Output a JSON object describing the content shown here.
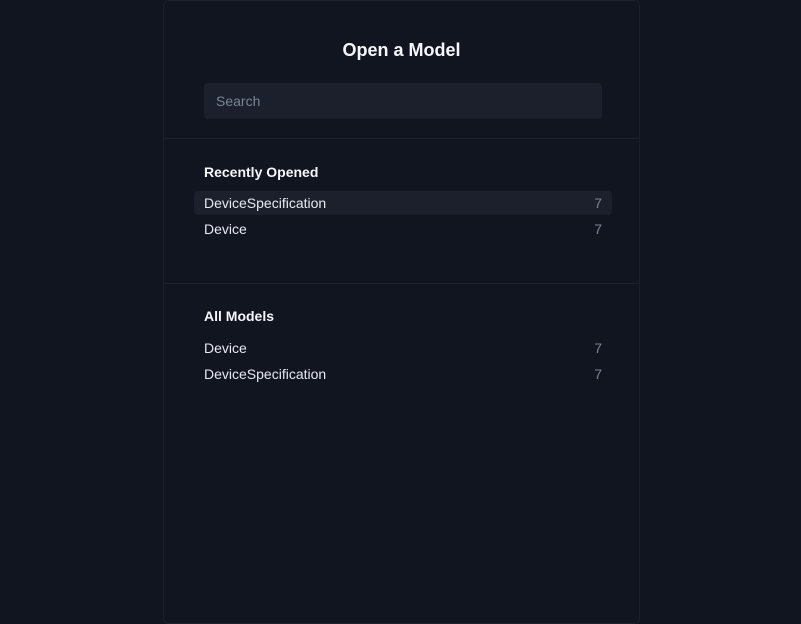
{
  "dialog": {
    "title": "Open a Model",
    "search": {
      "placeholder": "Search",
      "value": ""
    }
  },
  "recent": {
    "heading": "Recently Opened",
    "items": [
      {
        "name": "DeviceSpecification",
        "count": "7"
      },
      {
        "name": "Device",
        "count": "7"
      }
    ]
  },
  "all": {
    "heading": "All Models",
    "items": [
      {
        "name": "Device",
        "count": "7"
      },
      {
        "name": "DeviceSpecification",
        "count": "7"
      }
    ]
  }
}
